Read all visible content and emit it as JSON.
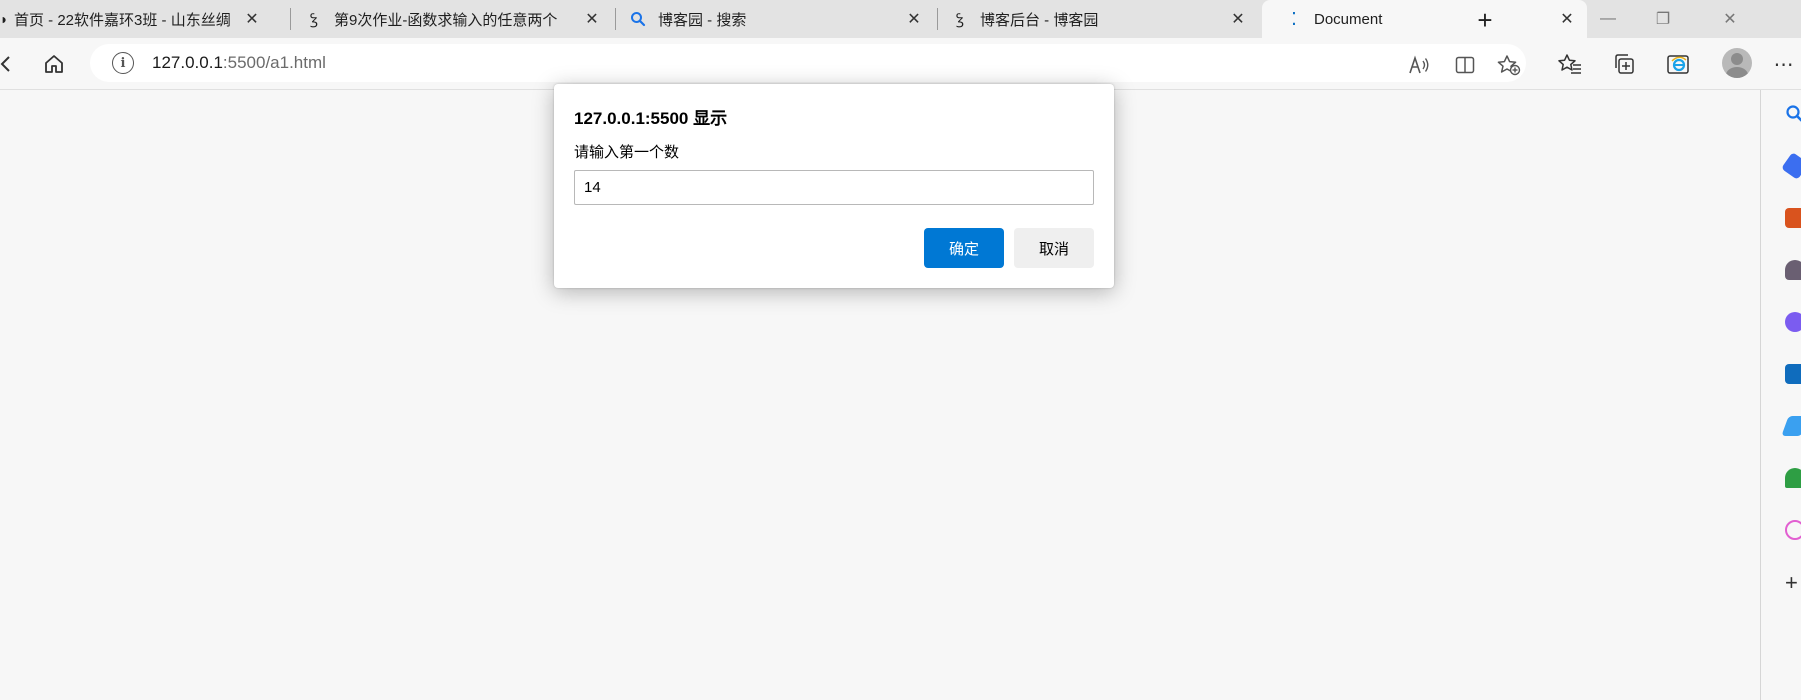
{
  "tabs": [
    {
      "title": "首页 - 22软件嘉环3班 - 山东丝绸",
      "icon": "cnblogs-icon",
      "active": false
    },
    {
      "title": "第9次作业-函数求输入的任意两个",
      "icon": "cnblogs-icon",
      "active": false
    },
    {
      "title": "博客园 - 搜索",
      "icon": "search-icon",
      "active": false
    },
    {
      "title": "博客后台 - 博客园",
      "icon": "cnblogs-icon",
      "active": false
    },
    {
      "title": "Document",
      "icon": "loading-icon",
      "active": true
    }
  ],
  "address": {
    "host": "127.0.0.1",
    "rest": ":5500/a1.html"
  },
  "dialog": {
    "title": "127.0.0.1:5500 显示",
    "message": "请输入第一个数",
    "input_value": "14",
    "ok_label": "确定",
    "cancel_label": "取消"
  },
  "colors": {
    "accent": "#0078d4",
    "page_bg": "#f7f7f7",
    "tabstrip_bg": "#e3e3e3"
  },
  "sidebar_icons": [
    "search-icon",
    "tag-icon",
    "toolbox-icon",
    "games-icon",
    "copilot-icon",
    "outlook-icon",
    "send-icon",
    "tree-icon",
    "drop-icon",
    "add-icon"
  ]
}
